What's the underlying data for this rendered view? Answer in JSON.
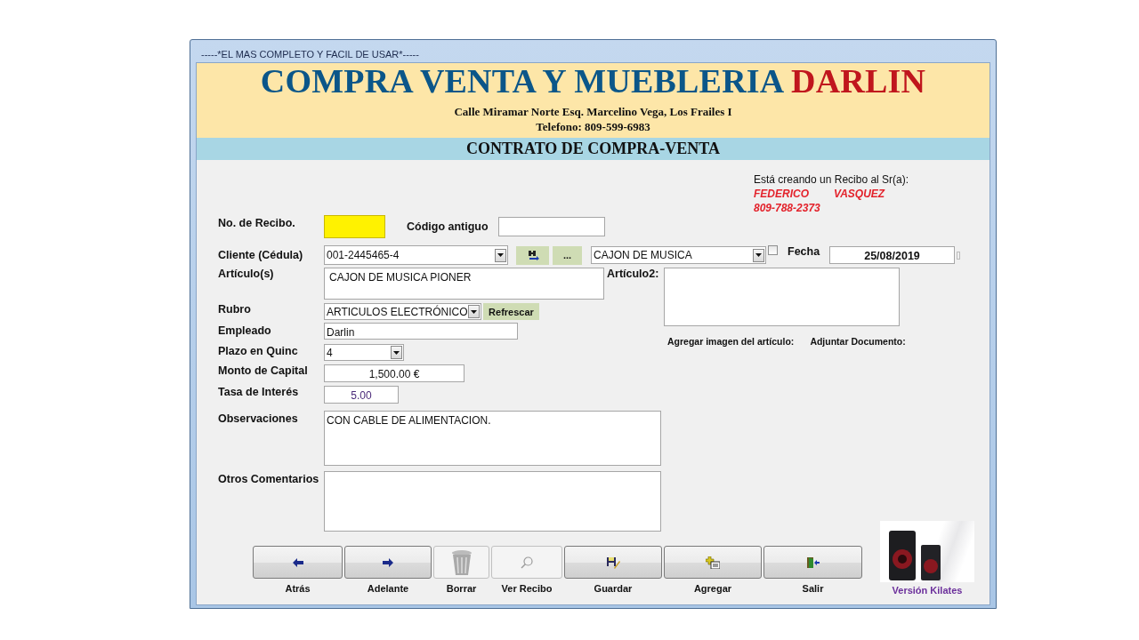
{
  "window": {
    "title": "-----*EL MAS COMPLETO Y FACIL DE USAR*-----"
  },
  "header": {
    "company_name": "COMPRA VENTA Y MUEBLERIA",
    "company_highlight": "DARLIN",
    "address": "Calle Miramar Norte Esq. Marcelino Vega, Los Frailes I",
    "phone": "Telefono: 809-599-6983"
  },
  "section_title": "CONTRATO DE COMPRA-VENTA",
  "client_notice": {
    "label": "Está creando un Recibo al Sr(a):",
    "first_name": "FEDERICO",
    "last_name": "VASQUEZ",
    "phone": "809-788-2373"
  },
  "receipt_no": {
    "label": "No. de Recibo."
  },
  "old_code": {
    "label": "Código antiguo"
  },
  "client": {
    "label": "Cliente (Cédula)",
    "value": "001-2445465-4"
  },
  "more_button": "...",
  "article_combo": {
    "value": "CAJON DE MUSICA"
  },
  "date_checkbox": {
    "checked": false
  },
  "date": {
    "label": "Fecha",
    "value": "25/08/2019"
  },
  "articles": {
    "label": "Artículo(s)",
    "value": "CAJON DE MUSICA PIONER"
  },
  "article2": {
    "label": "Artículo2:"
  },
  "category": {
    "label": "Rubro",
    "value": "ARTICULOS ELECTRÓNICO"
  },
  "refresh_button": "Refrescar",
  "employee": {
    "label": "Empleado",
    "value": "Darlin"
  },
  "term": {
    "label": "Plazo en Quinc",
    "value": "4"
  },
  "capital": {
    "label": "Monto de Capital",
    "value": "1,500.00 €"
  },
  "interest": {
    "label": "Tasa de Interés",
    "value": "5.00"
  },
  "attach_image_label": "Agregar imagen del artículo:",
  "attach_document_label": "Adjuntar Documento:",
  "observations": {
    "label": "Observaciones",
    "value": "CON CABLE DE ALIMENTACION."
  },
  "other_comments": {
    "label": "Otros Comentarios"
  },
  "toolbar": [
    {
      "kind": "back",
      "label": "Atrás",
      "disabled": false
    },
    {
      "kind": "forward",
      "label": "Adelante",
      "disabled": false
    },
    {
      "kind": "delete",
      "label": "Borrar",
      "disabled": true
    },
    {
      "kind": "view",
      "label": "Ver Recibo",
      "disabled": true
    },
    {
      "kind": "save",
      "label": "Guardar",
      "disabled": false
    },
    {
      "kind": "add",
      "label": "Agregar",
      "disabled": false
    },
    {
      "kind": "exit",
      "label": "Salir",
      "disabled": false
    }
  ],
  "version_label": "Versión Kilates"
}
